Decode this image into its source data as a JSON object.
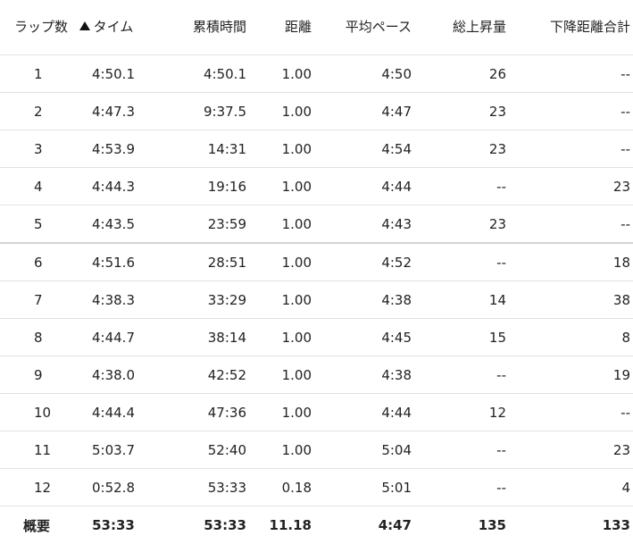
{
  "table": {
    "headers": {
      "lap": "ラップ数",
      "time": "タイム",
      "cumulative": "累積時間",
      "distance": "距離",
      "avg_pace": "平均ペース",
      "total_ascent": "総上昇量",
      "total_descent": "下降距離合計"
    },
    "sort_icon": "sort-ascending-triangle",
    "rows": [
      {
        "lap": "1",
        "time": "4:50.1",
        "cumulative": "4:50.1",
        "distance": "1.00",
        "avg_pace": "4:50",
        "total_ascent": "26",
        "total_descent": "--"
      },
      {
        "lap": "2",
        "time": "4:47.3",
        "cumulative": "9:37.5",
        "distance": "1.00",
        "avg_pace": "4:47",
        "total_ascent": "23",
        "total_descent": "--"
      },
      {
        "lap": "3",
        "time": "4:53.9",
        "cumulative": "14:31",
        "distance": "1.00",
        "avg_pace": "4:54",
        "total_ascent": "23",
        "total_descent": "--"
      },
      {
        "lap": "4",
        "time": "4:44.3",
        "cumulative": "19:16",
        "distance": "1.00",
        "avg_pace": "4:44",
        "total_ascent": "--",
        "total_descent": "23"
      },
      {
        "lap": "5",
        "time": "4:43.5",
        "cumulative": "23:59",
        "distance": "1.00",
        "avg_pace": "4:43",
        "total_ascent": "23",
        "total_descent": "--"
      },
      {
        "lap": "6",
        "time": "4:51.6",
        "cumulative": "28:51",
        "distance": "1.00",
        "avg_pace": "4:52",
        "total_ascent": "--",
        "total_descent": "18"
      },
      {
        "lap": "7",
        "time": "4:38.3",
        "cumulative": "33:29",
        "distance": "1.00",
        "avg_pace": "4:38",
        "total_ascent": "14",
        "total_descent": "38"
      },
      {
        "lap": "8",
        "time": "4:44.7",
        "cumulative": "38:14",
        "distance": "1.00",
        "avg_pace": "4:45",
        "total_ascent": "15",
        "total_descent": "8"
      },
      {
        "lap": "9",
        "time": "4:38.0",
        "cumulative": "42:52",
        "distance": "1.00",
        "avg_pace": "4:38",
        "total_ascent": "--",
        "total_descent": "19"
      },
      {
        "lap": "10",
        "time": "4:44.4",
        "cumulative": "47:36",
        "distance": "1.00",
        "avg_pace": "4:44",
        "total_ascent": "12",
        "total_descent": "--"
      },
      {
        "lap": "11",
        "time": "5:03.7",
        "cumulative": "52:40",
        "distance": "1.00",
        "avg_pace": "5:04",
        "total_ascent": "--",
        "total_descent": "23"
      },
      {
        "lap": "12",
        "time": "0:52.8",
        "cumulative": "53:33",
        "distance": "0.18",
        "avg_pace": "5:01",
        "total_ascent": "--",
        "total_descent": "4"
      }
    ],
    "summary": {
      "lap": "概要",
      "time": "53:33",
      "cumulative": "53:33",
      "distance": "11.18",
      "avg_pace": "4:47",
      "total_ascent": "135",
      "total_descent": "133"
    }
  }
}
